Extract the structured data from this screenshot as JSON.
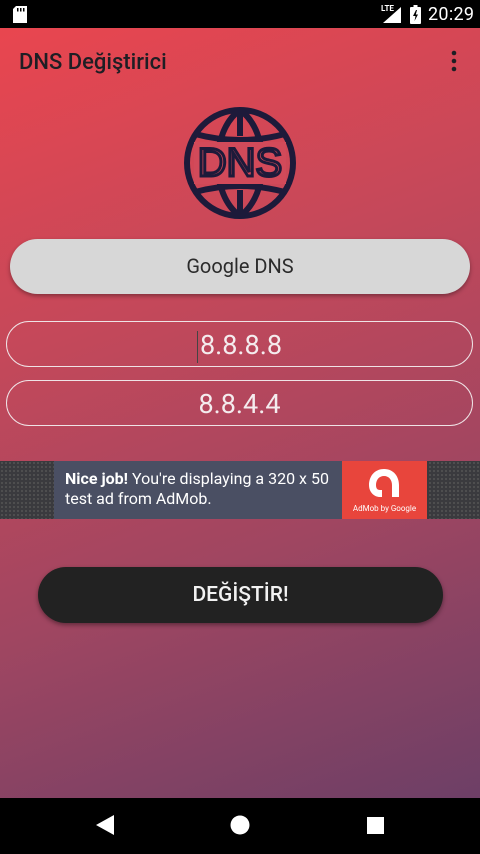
{
  "status_bar": {
    "network": "LTE",
    "time": "20:29",
    "icons": [
      "sd-card-icon",
      "signal-icon",
      "battery-charging-icon"
    ]
  },
  "app_bar": {
    "title": "DNS Değiştirici",
    "menu_icon": "overflow-menu-icon"
  },
  "logo": {
    "text": "DNS",
    "icon": "globe-icon",
    "color": "#1d1a3a"
  },
  "provider": {
    "label": "Google DNS"
  },
  "dns": {
    "primary": "8.8.8.8",
    "secondary": "8.8.4.4"
  },
  "ad": {
    "headline": "Nice job!",
    "body": " You're displaying a 320 x 50 test ad from AdMob.",
    "brand_caption": "AdMob by Google",
    "brand_color": "#e8453c"
  },
  "action": {
    "label": "DEĞİŞTİR!"
  },
  "nav_bar": {
    "icons": [
      "back-icon",
      "home-icon",
      "recents-icon"
    ]
  },
  "colors": {
    "gradient_start": "#e9464f",
    "gradient_end": "#6d3f66",
    "button_dark": "#222222",
    "button_light": "#d7d7d7"
  }
}
